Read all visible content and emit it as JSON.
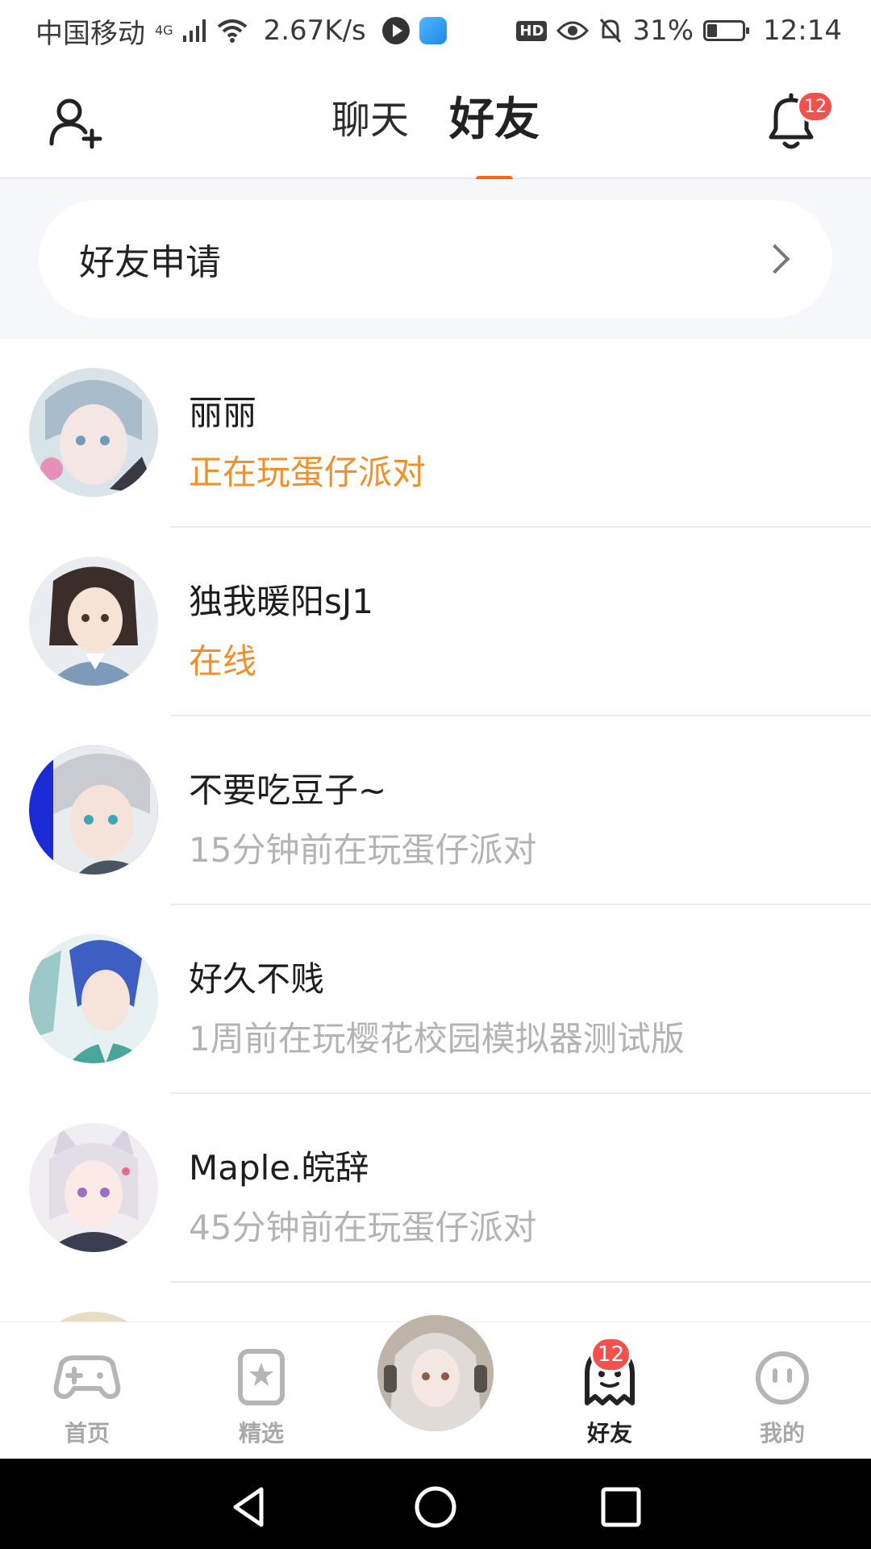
{
  "status_bar": {
    "carrier": "中国移动",
    "network": "4G",
    "speed": "2.67K/s",
    "hd": "HD",
    "battery": "31%",
    "time": "12:14"
  },
  "top_nav": {
    "tabs": [
      {
        "label": "聊天",
        "active": false
      },
      {
        "label": "好友",
        "active": true
      }
    ],
    "notification_count": "12"
  },
  "friend_request": {
    "label": "好友申请"
  },
  "friends": [
    {
      "name": "丽丽",
      "status": "正在玩蛋仔派对",
      "status_color": "#f0902a"
    },
    {
      "name": "独我暖阳sJ1",
      "status": "在线",
      "status_color": "#f0902a"
    },
    {
      "name": "不要吃豆子~",
      "status": "15分钟前在玩蛋仔派对",
      "status_color": "#b3b3b3"
    },
    {
      "name": "好久不贱",
      "status": "1周前在玩樱花校园模拟器测试版",
      "status_color": "#b3b3b3"
    },
    {
      "name": "Maple.皖辞",
      "status": "45分钟前在玩蛋仔派对",
      "status_color": "#b3b3b3"
    }
  ],
  "bottom_nav": {
    "items": [
      {
        "label": "首页",
        "icon": "gamepad-icon"
      },
      {
        "label": "精选",
        "icon": "star-bookmark-icon"
      },
      {
        "label": "好友",
        "icon": "ghost-icon",
        "badge": "12",
        "active": true
      },
      {
        "label": "我的",
        "icon": "face-icon"
      }
    ]
  },
  "colors": {
    "accent": "#ff6514",
    "badge": "#f4504c",
    "online_status": "#f0902a",
    "offline_status": "#b3b3b3"
  }
}
